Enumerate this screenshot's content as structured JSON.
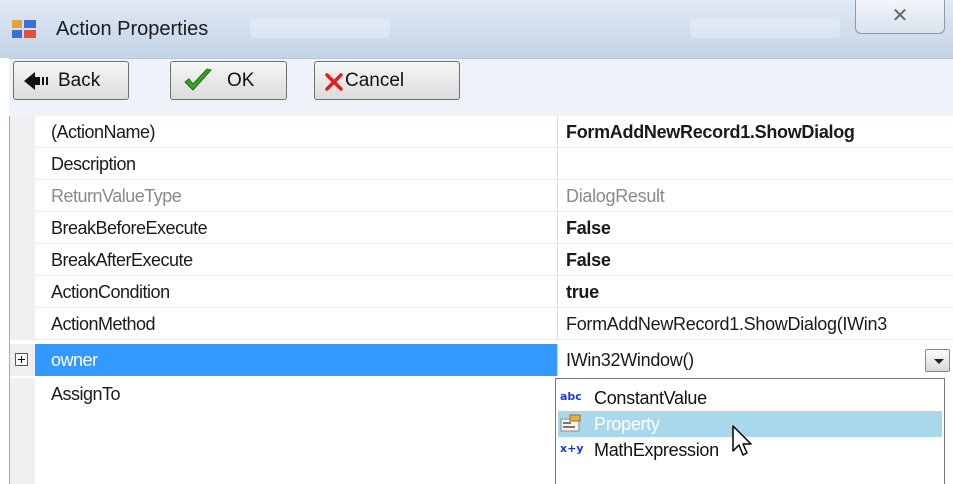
{
  "window": {
    "title": "Action Properties",
    "close_glyph": "✕"
  },
  "toolbar": {
    "back_label": "Back",
    "ok_label": "OK",
    "cancel_label": "Cancel"
  },
  "properties": [
    {
      "name": "(ActionName)",
      "value": "FormAddNewRecord1.ShowDialog"
    },
    {
      "name": "Description",
      "value": ""
    },
    {
      "name": "ReturnValueType",
      "value": "DialogResult"
    },
    {
      "name": "BreakBeforeExecute",
      "value": "False"
    },
    {
      "name": "BreakAfterExecute",
      "value": "False"
    },
    {
      "name": "ActionCondition",
      "value": "true"
    },
    {
      "name": "ActionMethod",
      "value": "FormAddNewRecord1.ShowDialog(IWin3"
    },
    {
      "name": "owner",
      "value": "IWin32Window()"
    },
    {
      "name": "AssignTo",
      "value": ""
    }
  ],
  "dropdown": {
    "items": [
      {
        "icon": "abc",
        "label": "ConstantValue"
      },
      {
        "icon": "property-icon",
        "label": "Property"
      },
      {
        "icon": "x+y",
        "label": "MathExpression"
      }
    ]
  },
  "colors": {
    "selection": "#3399ff",
    "dropdown_highlight": "#a8d8ea"
  }
}
